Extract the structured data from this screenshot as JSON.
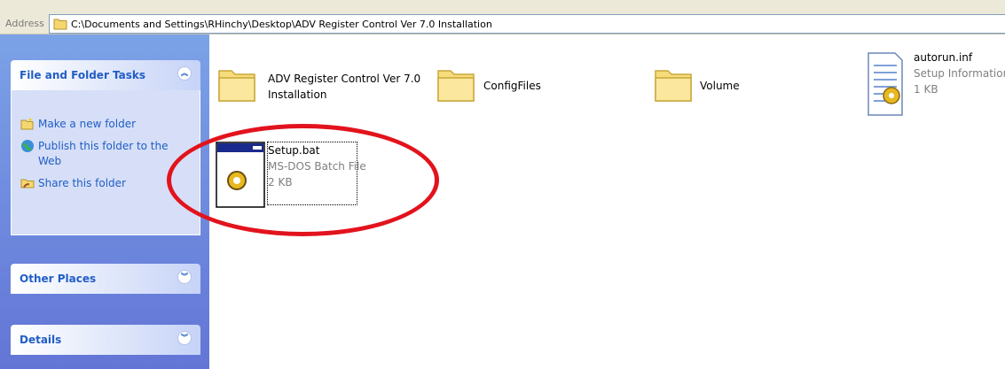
{
  "address_bar": {
    "label": "Address",
    "path": "C:\\Documents and Settings\\RHinchy\\Desktop\\ADV Register Control Ver 7.0 Installation"
  },
  "task_pane": {
    "file_folder_tasks": {
      "title": "File and Folder Tasks",
      "tasks": [
        {
          "label": "Make a new folder",
          "icon": "new-folder-icon"
        },
        {
          "label": "Publish this folder to the Web",
          "icon": "publish-web-icon"
        },
        {
          "label": "Share this folder",
          "icon": "share-folder-icon"
        }
      ]
    },
    "other_places": {
      "title": "Other Places"
    },
    "details": {
      "title": "Details"
    }
  },
  "files": [
    {
      "name": "ADV Register Control Ver 7.0",
      "name2": "Installation",
      "icon": "folder-icon"
    },
    {
      "name": "ConfigFiles",
      "icon": "folder-icon"
    },
    {
      "name": "Volume",
      "icon": "folder-icon"
    },
    {
      "name": "autorun.inf",
      "type": "Setup Information",
      "size": "1 KB",
      "icon": "setup-info-icon"
    },
    {
      "name": "Setup.bat",
      "type": "MS-DOS Batch File",
      "size": "2 KB",
      "icon": "batch-file-icon"
    }
  ],
  "colors": {
    "highlight_ellipse": "#e2131d",
    "task_pane_blue": "#6375d6",
    "link_blue": "#215dc6"
  }
}
